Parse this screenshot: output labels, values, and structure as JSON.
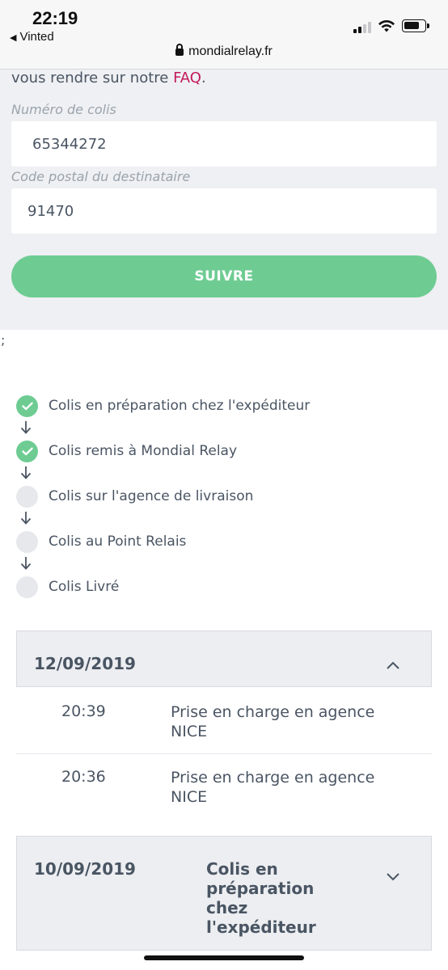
{
  "status_bar": {
    "time": "22:19",
    "back_app": "Vinted",
    "url": "mondialrelay.fr"
  },
  "form": {
    "intro_prefix": "vous rendre sur notre ",
    "faq_link": "FAQ",
    "intro_suffix": ".",
    "parcel_label": "Numéro de colis",
    "parcel_value": "65344272",
    "postal_label": "Code postal du destinataire",
    "postal_value": "91470",
    "submit_label": "SUIVRE",
    "accent_color": "#6ecc93",
    "link_color": "#c2185b"
  },
  "stray_char": ";",
  "steps": [
    {
      "label": "Colis en préparation chez l'expéditeur",
      "done": true
    },
    {
      "label": "Colis remis à Mondial Relay",
      "done": true
    },
    {
      "label": "Colis sur l'agence de livraison",
      "done": false
    },
    {
      "label": "Colis au Point Relais",
      "done": false
    },
    {
      "label": "Colis Livré",
      "done": false
    }
  ],
  "history": [
    {
      "date": "12/09/2019",
      "expanded": true,
      "events": [
        {
          "time": "20:39",
          "line1": "Prise en charge en agence",
          "line2": "NICE"
        },
        {
          "time": "20:36",
          "line1": "Prise en charge en agence",
          "line2": "NICE"
        }
      ]
    },
    {
      "date": "10/09/2019",
      "expanded": false,
      "status_lines": [
        "Colis en",
        "préparation",
        "chez",
        "l'expéditeur"
      ]
    }
  ]
}
